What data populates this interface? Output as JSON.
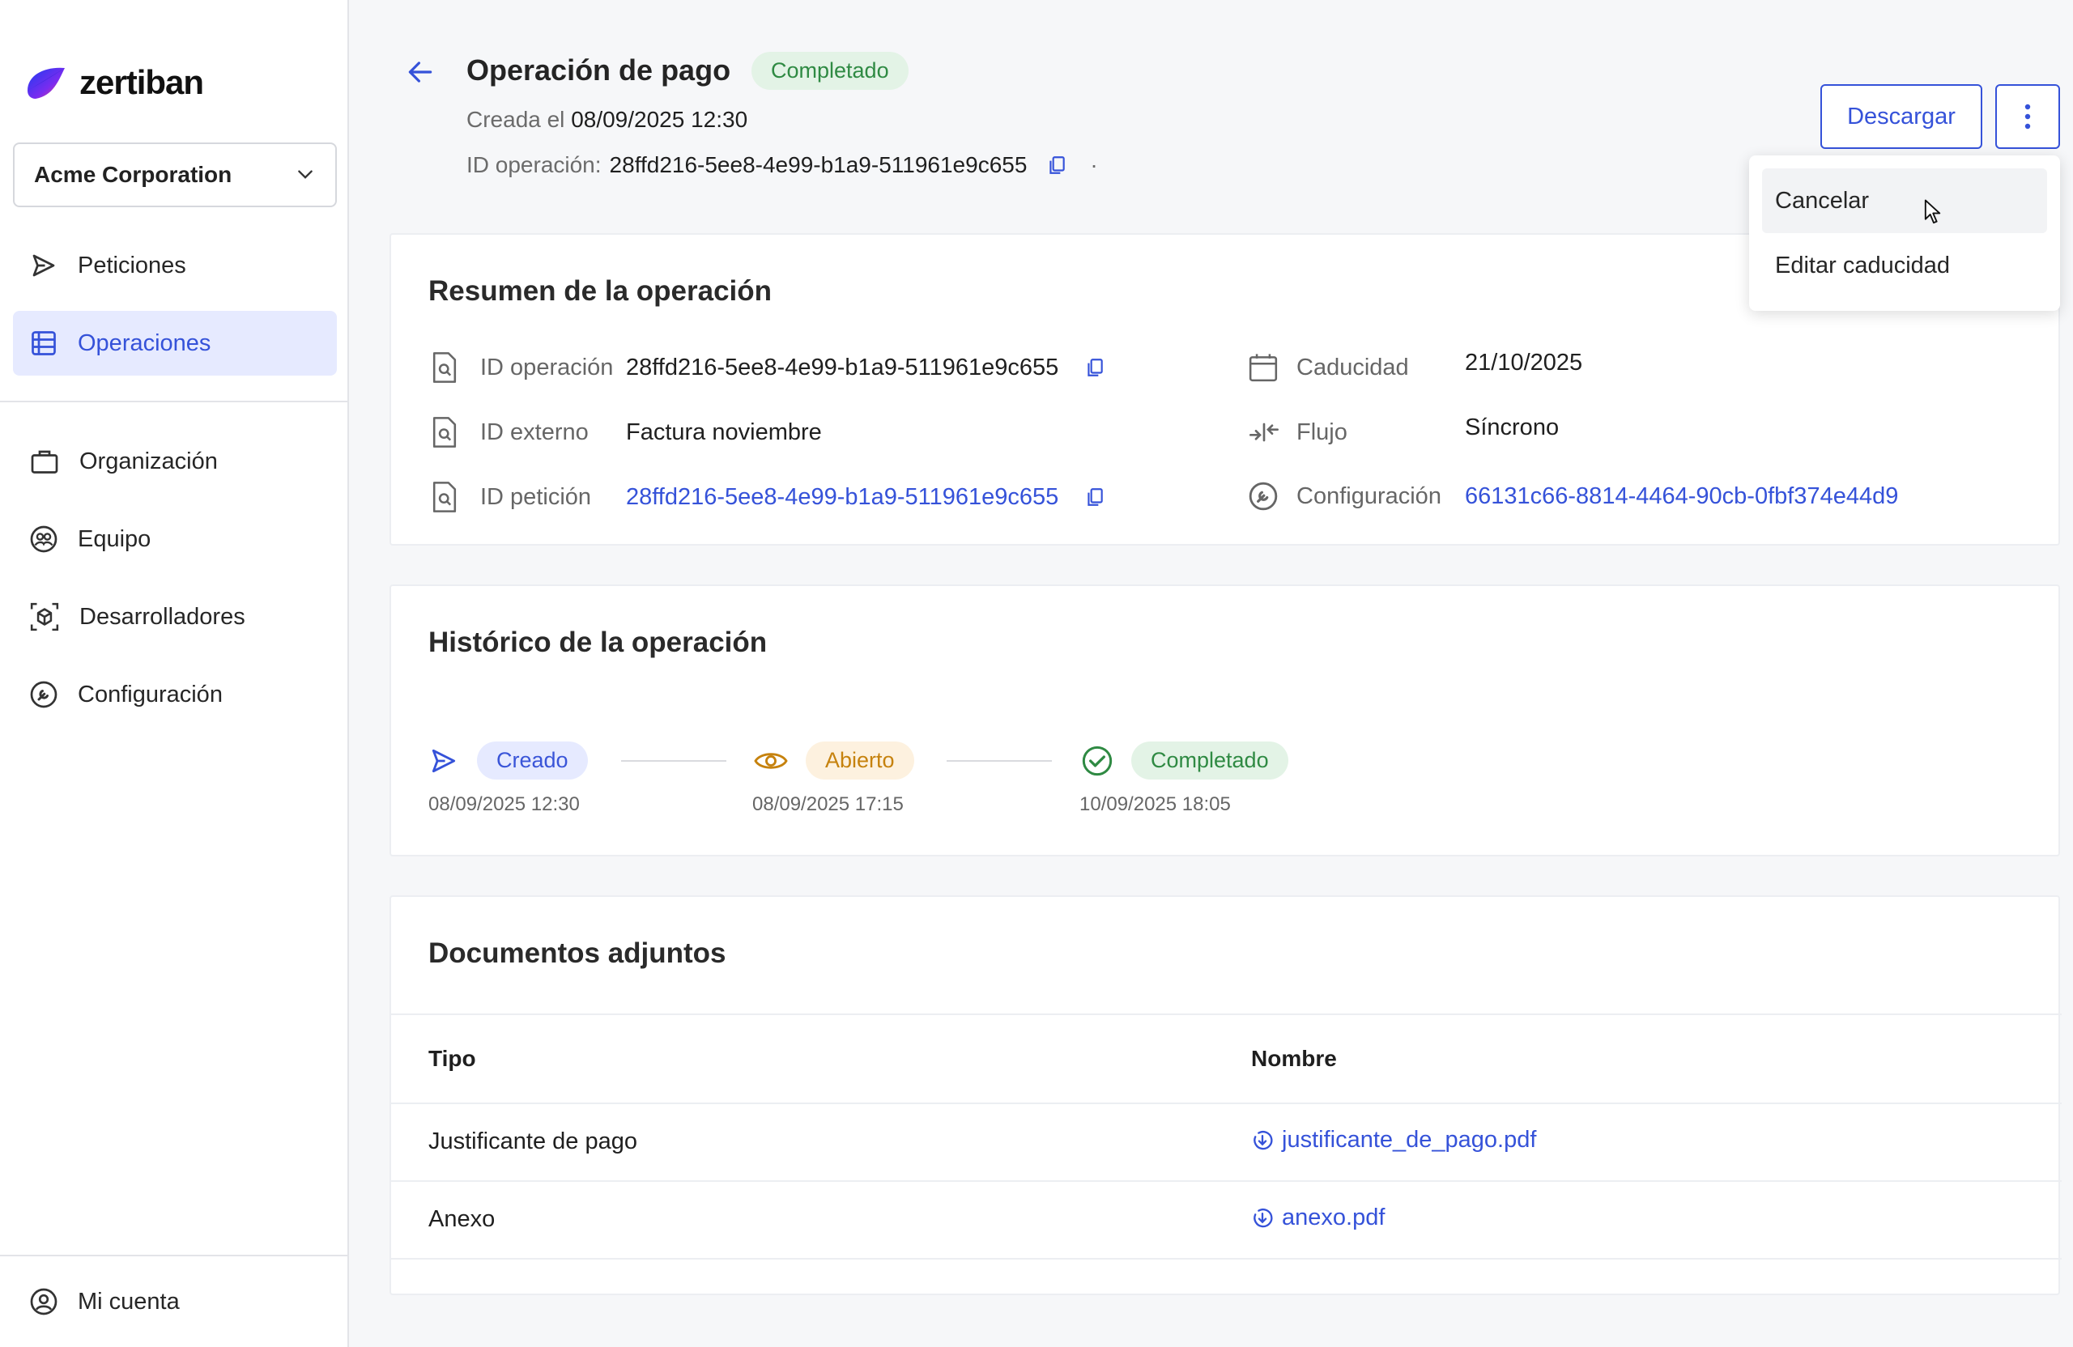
{
  "brand": {
    "name": "zertiban"
  },
  "sidebar": {
    "org": "Acme Corporation",
    "items": [
      {
        "label": "Peticiones"
      },
      {
        "label": "Operaciones"
      },
      {
        "label": "Organización"
      },
      {
        "label": "Equipo"
      },
      {
        "label": "Desarrolladores"
      },
      {
        "label": "Configuración"
      }
    ],
    "account": "Mi cuenta"
  },
  "header": {
    "title": "Operación de pago",
    "status": "Completado",
    "created_label": "Creada el",
    "created_value": "08/09/2025 12:30",
    "id_label": "ID operación:",
    "id_value": "28ffd216-5ee8-4e99-b1a9-511961e9c655",
    "dot": "·",
    "download": "Descargar"
  },
  "menu": {
    "items": [
      "Cancelar",
      "Editar caducidad"
    ]
  },
  "summary": {
    "title": "Resumen de la operación",
    "left": [
      {
        "label": "ID operación",
        "value": "28ffd216-5ee8-4e99-b1a9-511961e9c655"
      },
      {
        "label": "ID externo",
        "value": "Factura noviembre"
      },
      {
        "label": "ID petición",
        "value": "28ffd216-5ee8-4e99-b1a9-511961e9c655"
      }
    ],
    "right": [
      {
        "label": "Caducidad",
        "value": "21/10/2025"
      },
      {
        "label": "Flujo",
        "value": "Síncrono"
      },
      {
        "label": "Configuración",
        "value": "66131c66-8814-4464-90cb-0fbf374e44d9"
      }
    ]
  },
  "history": {
    "title": "Histórico de la operación",
    "steps": [
      {
        "label": "Creado",
        "date": "08/09/2025 12:30"
      },
      {
        "label": "Abierto",
        "date": "08/09/2025 17:15"
      },
      {
        "label": "Completado",
        "date": "10/09/2025 18:05"
      }
    ]
  },
  "documents": {
    "title": "Documentos adjuntos",
    "columns": [
      "Tipo",
      "Nombre"
    ],
    "rows": [
      {
        "type": "Justificante de pago",
        "name": "justificante_de_pago.pdf"
      },
      {
        "type": "Anexo",
        "name": "anexo.pdf"
      }
    ]
  },
  "colors": {
    "accent": "#3552d9",
    "success": "#2f8a43",
    "warning": "#c6820e"
  }
}
